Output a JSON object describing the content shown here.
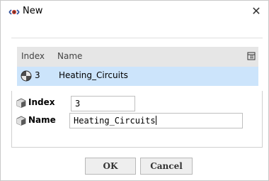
{
  "window": {
    "title": "New",
    "close_glyph": "✕"
  },
  "grid": {
    "columns": {
      "index": "Index",
      "name": "Name"
    },
    "rows": [
      {
        "index": "3",
        "name": "Heating_Circuits",
        "icon": "loop-icon",
        "selected": true
      }
    ],
    "selected_row_color": "#cce4fb",
    "header_color": "#e6e6e6"
  },
  "form": {
    "index_label": "Index",
    "index_value": "3",
    "name_label": "Name",
    "name_value": "Heating_Circuits"
  },
  "buttons": {
    "ok": "OK",
    "cancel": "Cancel"
  },
  "icons": {
    "app": "eye-icon",
    "config": "column-chooser-icon",
    "field": "cube-icon"
  }
}
